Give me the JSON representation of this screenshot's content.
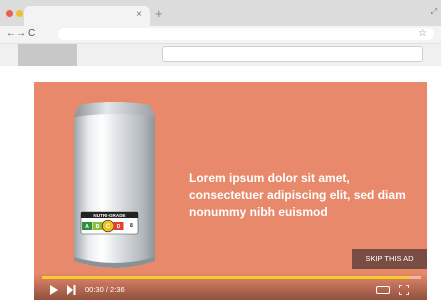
{
  "browser": {
    "dots": [
      {
        "name": "close-dot",
        "color": "#ec5f55"
      },
      {
        "name": "minimize-dot",
        "color": "#f3be33"
      },
      {
        "name": "zoom-dot",
        "color": "#5fc554"
      }
    ],
    "tab_close_icon": "×",
    "new_tab_icon": "+",
    "nav_icons": [
      "←",
      "→",
      "C"
    ],
    "bookmark_icon": "☆"
  },
  "ad": {
    "background": "#e8896b",
    "product_label": {
      "title": "NUTRI-GRADE",
      "grades": [
        {
          "letter": "A",
          "color": "#2f8f3e"
        },
        {
          "letter": "B",
          "color": "#8fbf3a"
        },
        {
          "letter": "C",
          "color": "#f2c21b"
        },
        {
          "letter": "D",
          "color": "#e2412b"
        }
      ],
      "selected_grade": "C",
      "sugar_text": "8"
    },
    "headline": "Lorem ipsum dolor sit amet, consectetuer adipiscing elit, sed diam nonummy nibh euismod",
    "skip_label": "SKIP THIS AD",
    "time": "00:30 / 2:36",
    "progress_fraction": 0.97,
    "progress_color": "#f3cd2f"
  }
}
